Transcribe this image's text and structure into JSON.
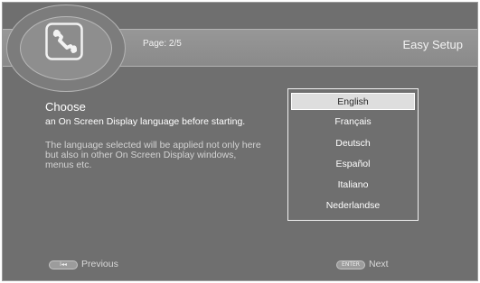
{
  "header": {
    "page_label": "Page: 2/5",
    "title": "Easy Setup",
    "icon": "wrench-icon"
  },
  "content": {
    "heading": "Choose",
    "description_primary": "an On Screen Display language before starting.",
    "description_secondary": "The language selected will be applied not only here but also in other On Screen Display windows, menus etc."
  },
  "languages": {
    "items": [
      "English",
      "Français",
      "Deutsch",
      "Español",
      "Italiano",
      "Nederlandse"
    ],
    "selected": "English"
  },
  "footer": {
    "previous_key": "I◂◂",
    "previous_label": "Previous",
    "next_key": "ENTER",
    "next_label": "Next"
  },
  "colors": {
    "background": "#6f6f6f",
    "header_band": "#8f8f8f",
    "selected_item": "#dedede",
    "text": "#ffffff"
  }
}
